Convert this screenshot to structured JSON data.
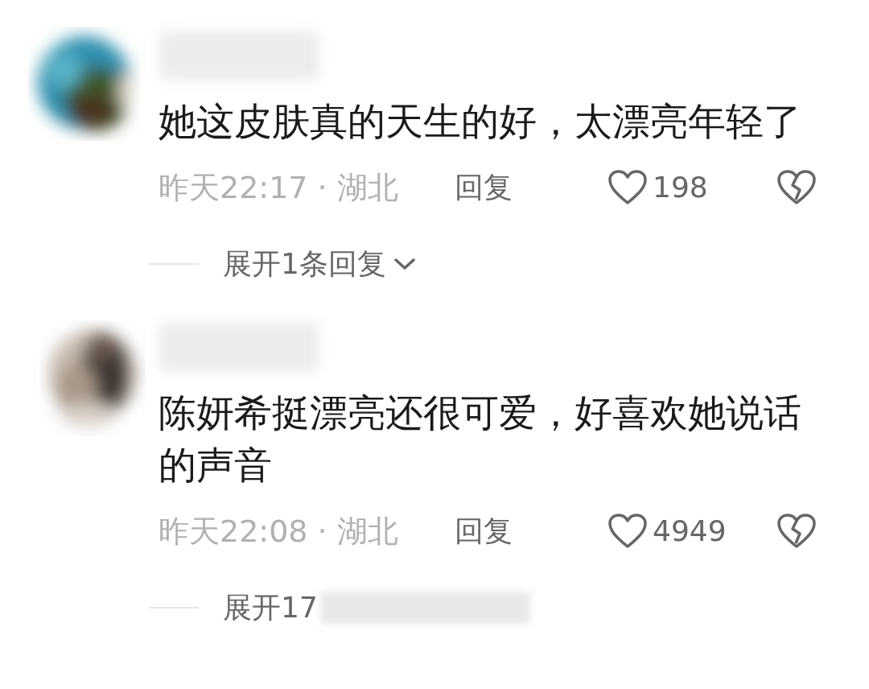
{
  "comments": [
    {
      "text": "她这皮肤真的天生的好，太漂亮年轻了",
      "time": "昨天22:17",
      "separator": "·",
      "location": "湖北",
      "reply_label": "回复",
      "likes": "198",
      "expand": {
        "label": "展开1条回复",
        "obscured": false
      }
    },
    {
      "text": "陈妍希挺漂亮还很可爱，好喜欢她说话的声音",
      "time": "昨天22:08",
      "separator": "·",
      "location": "湖北",
      "reply_label": "回复",
      "likes": "4949",
      "expand": {
        "label": "展开17",
        "obscured": true
      }
    }
  ]
}
